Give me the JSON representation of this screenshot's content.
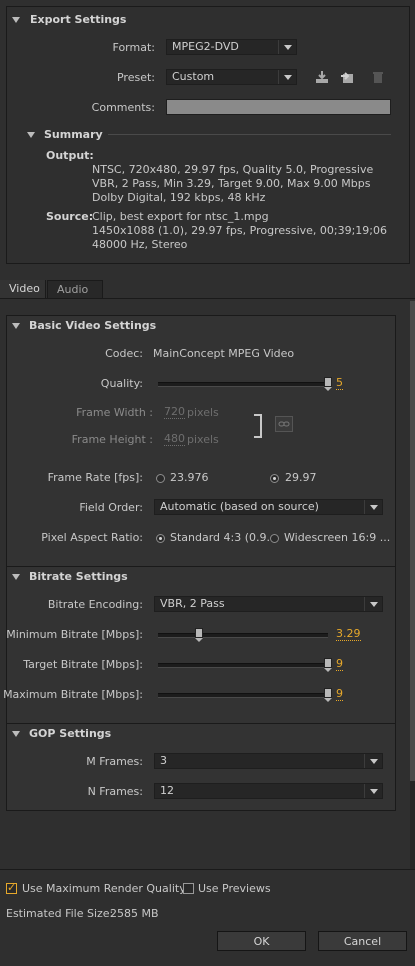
{
  "export_settings": {
    "title": "Export Settings",
    "format_label": "Format:",
    "format_value": "MPEG2-DVD",
    "preset_label": "Preset:",
    "preset_value": "Custom",
    "comments_label": "Comments:",
    "comments_value": ""
  },
  "summary": {
    "title": "Summary",
    "output_label": "Output:",
    "output_lines": [
      "NTSC, 720x480, 29.97 fps, Quality 5.0, Progressive",
      "VBR, 2 Pass, Min 3.29, Target 9.00, Max 9.00 Mbps",
      "Dolby Digital, 192 kbps, 48 kHz"
    ],
    "source_label": "Source:",
    "source_lines": [
      "Clip, best export for ntsc_1.mpg",
      "1450x1088 (1.0), 29.97 fps, Progressive, 00;39;19;06",
      "48000 Hz, Stereo"
    ]
  },
  "tabs": [
    "Video",
    "Audio"
  ],
  "basic_video": {
    "title": "Basic Video Settings",
    "codec_label": "Codec:",
    "codec_value": "MainConcept MPEG Video",
    "quality_label": "Quality:",
    "quality_value": "5",
    "quality_fraction": 1.0,
    "frame_width_label": "Frame Width :",
    "frame_width_value": "720",
    "frame_height_label": "Frame Height :",
    "frame_height_value": "480",
    "pixels_unit": "pixels",
    "frame_rate_label": "Frame Rate [fps]:",
    "frame_rate_options": [
      "23.976",
      "29.97"
    ],
    "frame_rate_selected": "29.97",
    "field_order_label": "Field Order:",
    "field_order_value": "Automatic (based on source)",
    "par_label": "Pixel Aspect Ratio:",
    "par_options": [
      "Standard 4:3 (0.9...",
      "Widescreen 16:9 ..."
    ],
    "par_selected": "Standard 4:3 (0.9..."
  },
  "bitrate": {
    "title": "Bitrate Settings",
    "encoding_label": "Bitrate Encoding:",
    "encoding_value": "VBR, 2 Pass",
    "min_label": "Minimum Bitrate [Mbps]:",
    "min_value": "3.29",
    "min_fraction": 0.24,
    "target_label": "Target Bitrate [Mbps]:",
    "target_value": "9",
    "target_fraction": 1.0,
    "max_label": "Maximum Bitrate [Mbps]:",
    "max_value": "9",
    "max_fraction": 1.0
  },
  "gop": {
    "title": "GOP Settings",
    "m_label": "M Frames:",
    "m_value": "3",
    "n_label": "N Frames:",
    "n_value": "12"
  },
  "footer": {
    "max_quality_label": "Use Maximum Render Quality",
    "max_quality_checked": true,
    "previews_label": "Use Previews",
    "previews_checked": false,
    "file_size_label": "Estimated File Size:",
    "file_size_value": "2585 MB",
    "ok_label": "OK",
    "cancel_label": "Cancel"
  },
  "colors": {
    "accent": "#e6a82b",
    "background": "#2f2f2f",
    "panel": "#333333"
  }
}
